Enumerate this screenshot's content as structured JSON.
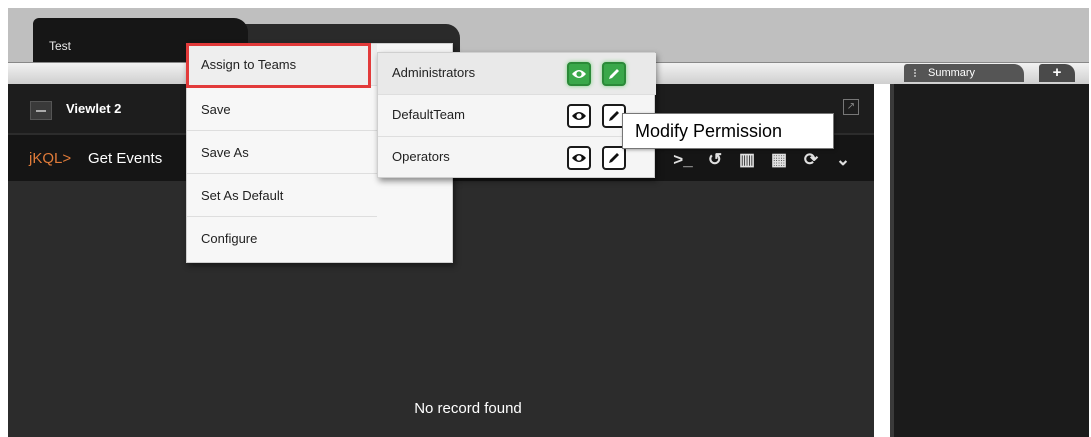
{
  "tabs": {
    "active_label": "Test"
  },
  "viewlet": {
    "title": "Viewlet 2",
    "query_prefix": "jKQL>",
    "query_name": "Get Events",
    "empty_message": "No record found"
  },
  "right_panel": {
    "summary_tab_label": "Summary",
    "add_tab_label": "+"
  },
  "context_menu": {
    "items": [
      {
        "label": "Assign to Teams"
      },
      {
        "label": "Save"
      },
      {
        "label": "Save As"
      },
      {
        "label": "Set As Default"
      },
      {
        "label": "Configure"
      }
    ],
    "highlight_color": "#e23a3a"
  },
  "teams_submenu": {
    "teams": [
      {
        "name": "Administrators",
        "view_enabled": true,
        "edit_enabled": true
      },
      {
        "name": "DefaultTeam",
        "view_enabled": false,
        "edit_enabled": false
      },
      {
        "name": "Operators",
        "view_enabled": false,
        "edit_enabled": false
      }
    ],
    "enabled_color": "#3aa84a"
  },
  "tooltip": {
    "text": "Modify Permission"
  },
  "toolbar_icons": [
    "terminal-icon",
    "undo-icon",
    "bar-chart-icon",
    "calendar-icon",
    "refresh-icon",
    "chevron-down-icon"
  ]
}
